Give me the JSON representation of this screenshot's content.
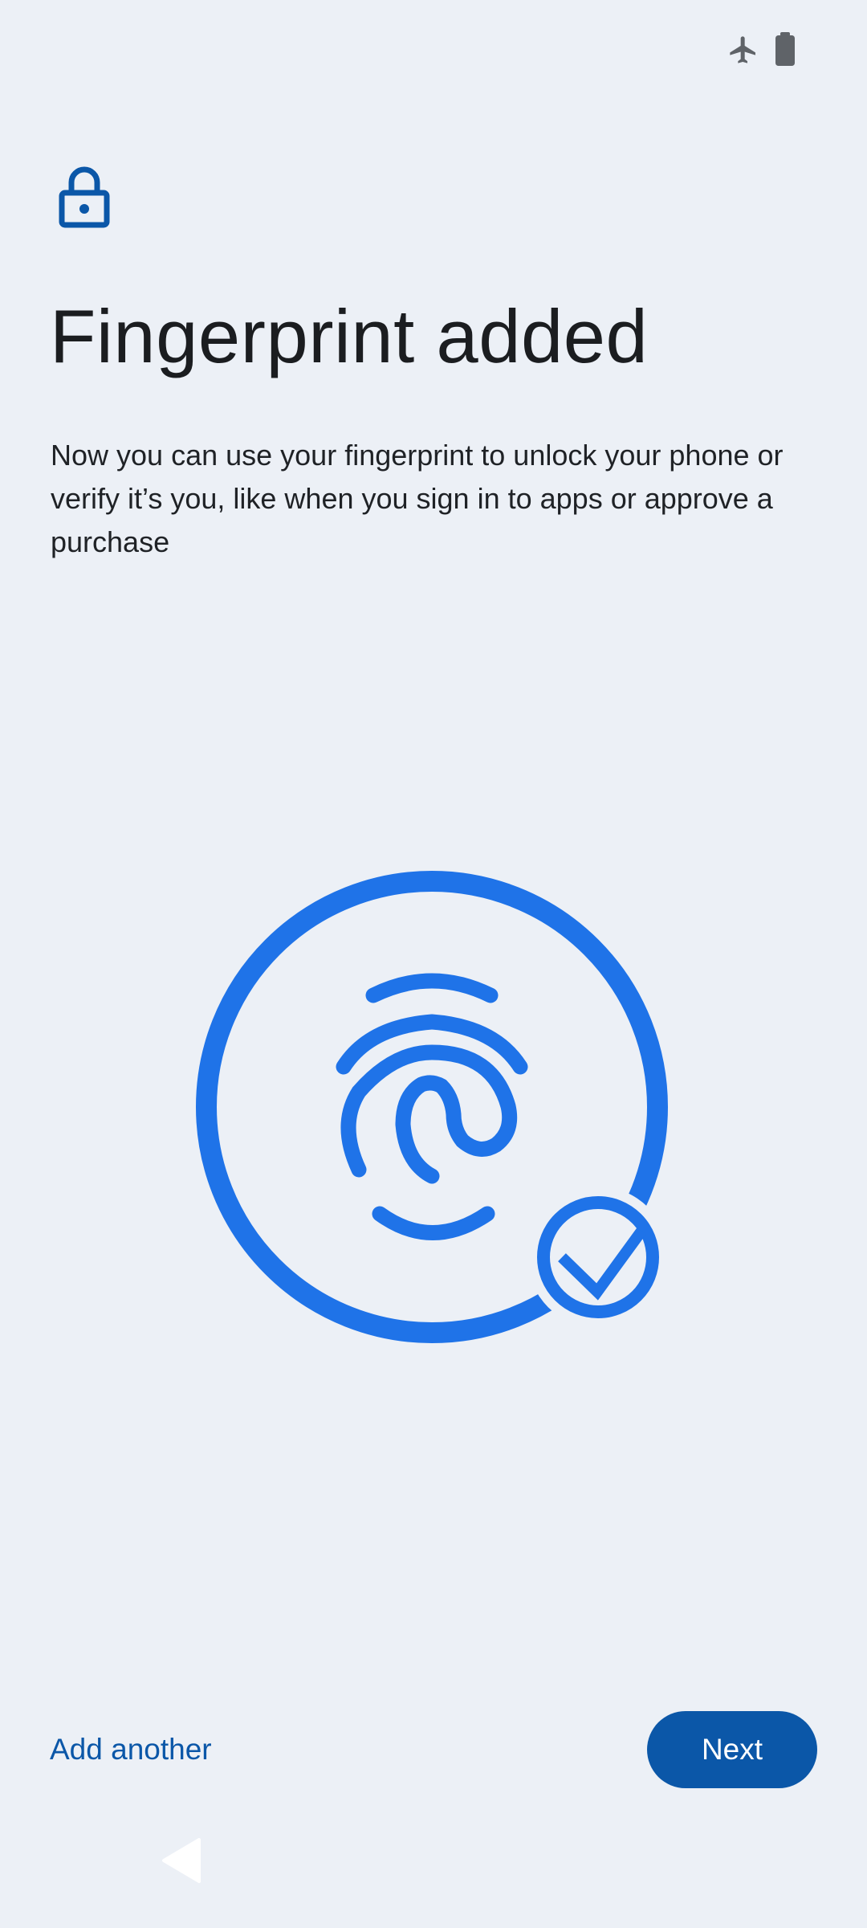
{
  "status_bar": {
    "icons": [
      "airplane-mode-icon",
      "battery-icon"
    ]
  },
  "header": {
    "icon": "lock-icon",
    "title": "Fingerprint added"
  },
  "body": {
    "description": "Now you can use your fingerprint to unlock your phone or verify it’s you, like when you sign in to apps or approve a purchase",
    "illustration": {
      "icon": "fingerprint-icon",
      "badge_icon": "checkmark-icon"
    }
  },
  "footer": {
    "secondary_label": "Add another",
    "primary_label": "Next"
  },
  "nav_bar": {
    "back_icon": "back-triangle-icon"
  },
  "colors": {
    "background": "#ecf0f6",
    "accent": "#0b57a8",
    "illustration": "#1f73e8",
    "status_icons": "#5f6368",
    "title_text": "#1b1d20"
  }
}
